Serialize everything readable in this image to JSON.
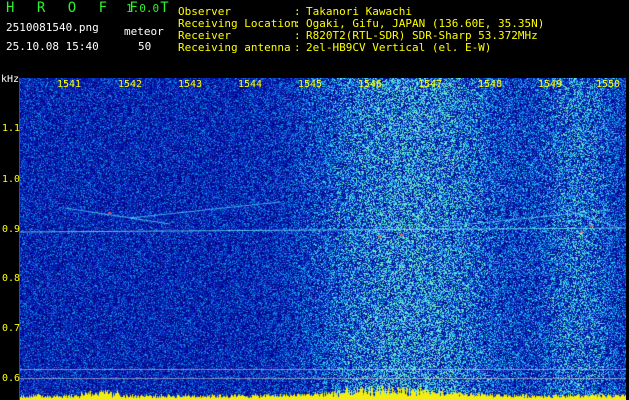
{
  "header": {
    "app_title": "H R O F F T",
    "app_version": "1.0.0",
    "file_name": "2510081540.png",
    "meteor_label": "meteor",
    "date_time": "25.10.08 15:40",
    "meteor_count": "50"
  },
  "station_info": [
    {
      "label": "Observer",
      "value": "Takanori Kawachi"
    },
    {
      "label": "Receiving Location",
      "value": "Ogaki, Gifu, JAPAN (136.60E, 35.35N)"
    },
    {
      "label": "Receiver",
      "value": "R820T2(RTL-SDR) SDR-Sharp 53.372MHz"
    },
    {
      "label": "Receiving antenna",
      "value": "2el-HB9CV Vertical (el. E-W)"
    }
  ],
  "axes": {
    "y_unit": "kHz",
    "y_ticks": [
      "1.1",
      "1.0",
      "0.9",
      "0.8",
      "0.7",
      "0.6"
    ],
    "x_ticks": [
      "1541",
      "1542",
      "1543",
      "1544",
      "1545",
      "1546",
      "1547",
      "1548",
      "1549",
      "1550"
    ]
  },
  "colors": {
    "background": "#000000",
    "title_green": "#2ff12f",
    "label_yellow": "#ffff00",
    "noise_blue": "#0a1cc8",
    "signal_cyan": "#5fe8ff"
  }
}
